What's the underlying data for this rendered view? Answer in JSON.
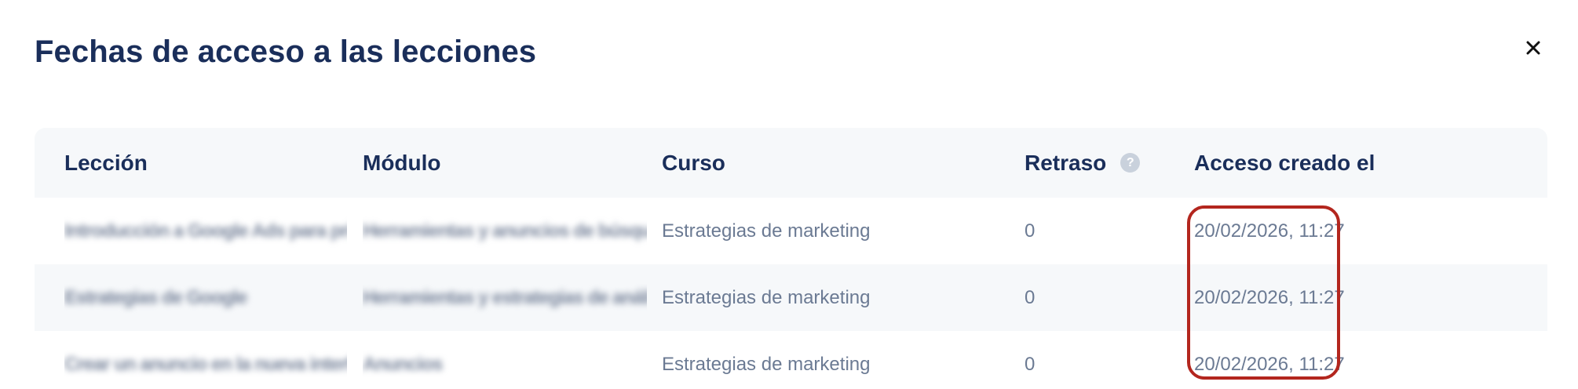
{
  "modal": {
    "title": "Fechas de acceso a las lecciones",
    "close_icon": "close-icon",
    "close_glyph": "✕"
  },
  "table": {
    "headers": {
      "lesson": "Lección",
      "module": "Módulo",
      "course": "Curso",
      "delay": "Retraso",
      "delay_help_icon": "help-icon",
      "delay_help_glyph": "?",
      "access_created": "Acceso creado el"
    },
    "rows": [
      {
        "lesson": "Introducción a Google Ads para principiantes",
        "module": "Herramientas y anuncios de búsqueda en",
        "course": "Estrategias de marketing",
        "delay": "0",
        "access_created": "20/02/2026, 11:27"
      },
      {
        "lesson": "Estrategias de Google",
        "module": "Herramientas y estrategias de análisis",
        "course": "Estrategias de marketing",
        "delay": "0",
        "access_created": "20/02/2026, 11:27"
      },
      {
        "lesson": "Crear un anuncio en la nueva interfaz",
        "module": "Anuncios",
        "course": "Estrategias de marketing",
        "delay": "0",
        "access_created": "20/02/2026, 11:27"
      }
    ]
  },
  "colors": {
    "title": "#1a2e5a",
    "body_text": "#6b7a93",
    "header_bg": "#f6f8fa",
    "highlight": "#b3261e"
  }
}
